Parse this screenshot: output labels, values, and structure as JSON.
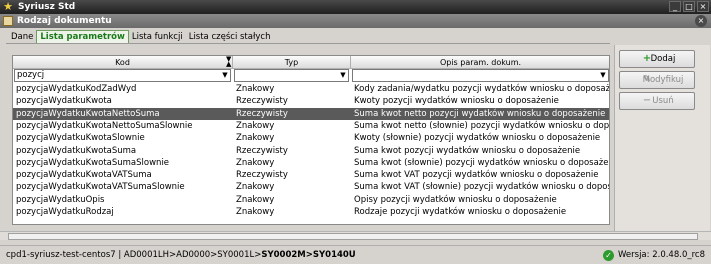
{
  "window": {
    "title": "Syriusz Std",
    "minimize": "_",
    "maximize": "□",
    "close": "×"
  },
  "form": {
    "title": "Rodzaj dokumentu",
    "close": "×"
  },
  "tabs": [
    {
      "label": "Dane"
    },
    {
      "label": "Lista parametrów",
      "active": true
    },
    {
      "label": "Lista funkcji"
    },
    {
      "label": "Lista części stałych"
    }
  ],
  "grid": {
    "columns": [
      "Kod",
      "Typ",
      "Opis param. dokum."
    ],
    "filters": {
      "kod": "pozycj",
      "typ": "",
      "opis": ""
    },
    "rows": [
      [
        "pozycjaWydatkuKodZadWyd",
        "Znakowy",
        "Kody zadania/wydatku pozycji wydatków wniosku o doposażenie"
      ],
      [
        "pozycjaWydatkuKwota",
        "Rzeczywisty",
        "Kwoty pozycji wydatków wniosku o doposażenie"
      ],
      [
        "pozycjaWydatkuKwotaNettoSuma",
        "Rzeczywisty",
        "Suma kwot netto pozycji wydatków wniosku o doposażenie"
      ],
      [
        "pozycjaWydatkuKwotaNettoSumaSlownie",
        "Znakowy",
        "Suma kwot netto (słownie) pozycji wydatków wniosku o doposażenie"
      ],
      [
        "pozycjaWydatkuKwotaSlownie",
        "Znakowy",
        "Kwoty (słownie) pozycji wydatków wniosku o doposażenie"
      ],
      [
        "pozycjaWydatkuKwotaSuma",
        "Rzeczywisty",
        "Suma kwot pozycji wydatków wniosku o doposażenie"
      ],
      [
        "pozycjaWydatkuKwotaSumaSlownie",
        "Znakowy",
        "Suma kwot (słownie) pozycji wydatków wniosku o doposażenie"
      ],
      [
        "pozycjaWydatkuKwotaVATSuma",
        "Rzeczywisty",
        "Suma kwot VAT pozycji wydatków wniosku o doposażenie"
      ],
      [
        "pozycjaWydatkuKwotaVATSumaSlownie",
        "Znakowy",
        "Suma kwot VAT (słownie) pozycji wydatków wniosku o doposażenie"
      ],
      [
        "pozycjaWydatkuOpis",
        "Znakowy",
        "Opisy pozycji wydatków wniosku o doposażenie"
      ],
      [
        "pozycjaWydatkuRodzaj",
        "Znakowy",
        "Rodzaje pozycji wydatków wniosku o doposażenie"
      ]
    ],
    "selected_index": 2
  },
  "buttons": {
    "add": "Dodaj",
    "modify": "Modyfikuj",
    "delete": "Usuń"
  },
  "status": {
    "path_prefix": "cpd1-syriusz-test-centos7 | AD0001LH>AD0000>SY0001L>",
    "path_bold": "SY0002M>SY0140U",
    "version": "Wersja: 2.0.48.0_rc8"
  },
  "colors": {
    "selected_row": "#5a5a5a",
    "active_tab": "#1a7a1a",
    "add_icon": "#2c9a2c"
  }
}
